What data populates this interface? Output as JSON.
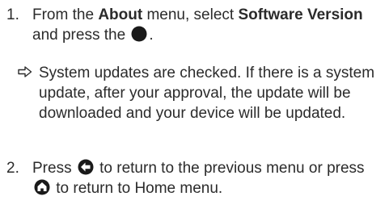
{
  "steps": [
    {
      "number": "1.",
      "parts": {
        "p1": "From the ",
        "about": "About",
        "p2": " menu, select ",
        "software_version": "Software Version",
        "p3": " and press the ",
        "p4": "."
      },
      "icons": [
        "ok-circle-icon"
      ],
      "note": {
        "icon": "arrow-right-icon",
        "text": "System updates are checked. If there is a system update, after your approval, the update will be downloaded and your device will be updated."
      }
    },
    {
      "number": "2.",
      "parts": {
        "p1": "Press ",
        "p2": " to return to the previous menu or press ",
        "p3": " to return to Home menu."
      },
      "icons": [
        "back-arrow-circle-icon",
        "home-circle-icon"
      ]
    }
  ]
}
